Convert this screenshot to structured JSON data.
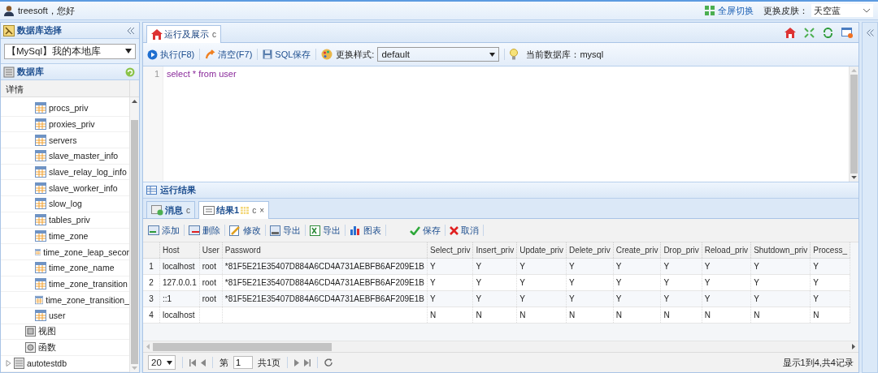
{
  "top_bar": {
    "user": "treesoft，您好",
    "fullscreen": "全屏切换",
    "skin_label": "更换皮肤：",
    "skin": "天空蓝"
  },
  "left_panel": {
    "title": "数据库选择",
    "database_select": "【MySql】我的本地库",
    "db_title": "数据库",
    "column_header": "详情",
    "tree": [
      {
        "children": [
          {
            "children": [
              {
                "kind": "table",
                "label": "procs_priv"
              },
              {
                "kind": "table",
                "label": "proxies_priv"
              },
              {
                "kind": "table",
                "label": "servers"
              },
              {
                "kind": "table",
                "label": "slave_master_info"
              },
              {
                "kind": "table",
                "label": "slave_relay_log_info"
              },
              {
                "kind": "table",
                "label": "slave_worker_info"
              },
              {
                "kind": "table",
                "label": "slow_log"
              },
              {
                "kind": "table",
                "label": "tables_priv"
              },
              {
                "kind": "table",
                "label": "time_zone"
              },
              {
                "kind": "table",
                "label": "time_zone_leap_secor"
              },
              {
                "kind": "table",
                "label": "time_zone_name"
              },
              {
                "kind": "table",
                "label": "time_zone_transition"
              },
              {
                "kind": "table",
                "label": "time_zone_transition_"
              },
              {
                "kind": "table",
                "label": "user"
              }
            ]
          },
          {
            "kind": "view",
            "label": "视图"
          },
          {
            "kind": "function",
            "label": "函数"
          }
        ]
      },
      {
        "kind": "database",
        "label": "autotestdb",
        "expanded": false
      }
    ]
  },
  "main": {
    "tabs": [
      {
        "label": "运行及展示",
        "refresh": "c",
        "selected": true
      }
    ],
    "toolbar": [
      {
        "kind": "run",
        "label": "执行(F8)"
      },
      {
        "kind": "clear",
        "label": "清空(F7)"
      },
      {
        "kind": "save",
        "label": "SQL保存"
      }
    ],
    "style_label": "更换样式:",
    "style_value": "default",
    "current_db": "当前数据库：mysql",
    "editor": [
      {
        "number": "1",
        "text": "select * from user"
      }
    ]
  },
  "results": {
    "title": "运行结果",
    "tabs": [
      {
        "kind": "message",
        "label": "消息",
        "refresh": "c",
        "selected": false
      },
      {
        "kind": "result",
        "label": "结果1",
        "refresh": "c",
        "close": "×",
        "selected": true
      }
    ],
    "toolbar": [
      {
        "kind": "add",
        "label": "添加"
      },
      {
        "kind": "delete",
        "label": "删除"
      },
      {
        "kind": "edit",
        "label": "修改"
      },
      {
        "kind": "export",
        "label": "导出"
      },
      {
        "kind": "export_excel",
        "label": "导出"
      },
      {
        "kind": "chart",
        "label": "图表"
      },
      {
        "kind": "save",
        "label": "保存"
      },
      {
        "kind": "cancel",
        "label": "取消"
      }
    ],
    "columns": [
      "Host",
      "User",
      "Password",
      "Select_priv",
      "Insert_priv",
      "Update_priv",
      "Delete_priv",
      "Create_priv",
      "Drop_priv",
      "Reload_priv",
      "Shutdown_priv",
      "Process_"
    ],
    "rows": [
      {
        "number": "1",
        "cells": [
          "localhost",
          "root",
          "*81F5E21E35407D884A6CD4A731AEBFB6AF209E1B",
          "Y",
          "Y",
          "Y",
          "Y",
          "Y",
          "Y",
          "Y",
          "Y",
          "Y"
        ]
      },
      {
        "number": "2",
        "cells": [
          "127.0.0.1",
          "root",
          "*81F5E21E35407D884A6CD4A731AEBFB6AF209E1B",
          "Y",
          "Y",
          "Y",
          "Y",
          "Y",
          "Y",
          "Y",
          "Y",
          "Y"
        ]
      },
      {
        "number": "3",
        "cells": [
          "::1",
          "root",
          "*81F5E21E35407D884A6CD4A731AEBFB6AF209E1B",
          "Y",
          "Y",
          "Y",
          "Y",
          "Y",
          "Y",
          "Y",
          "Y",
          "Y"
        ]
      },
      {
        "number": "4",
        "cells": [
          "localhost",
          "",
          "",
          "N",
          "N",
          "N",
          "N",
          "N",
          "N",
          "N",
          "N",
          "N"
        ]
      }
    ],
    "pager": {
      "page_size": "20",
      "page_label": "第",
      "page": "1",
      "total_pages": "共1页",
      "summary": "显示1到4,共4记录"
    }
  }
}
